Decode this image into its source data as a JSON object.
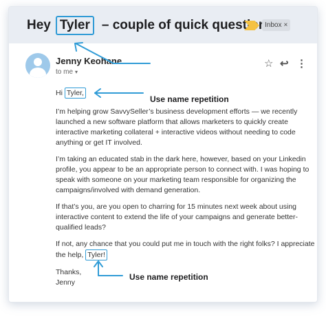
{
  "email": {
    "subject": {
      "prefix": "Hey",
      "name": "Tyler",
      "rest": "– couple of quick questions"
    },
    "label_chip": {
      "text": "Inbox",
      "close": "×"
    },
    "sender": {
      "name": "Jenny Keohane",
      "to": "to me",
      "caret": "▾"
    },
    "actions": {
      "star": "☆",
      "reply": "↩",
      "more": "⋮"
    },
    "body": {
      "greeting_prefix": "Hi",
      "greeting_name": "Tyler,",
      "p1": [
        "I’m helping grow SavvySeller’s business development efforts — we recently",
        "launched a new software platform that allows marketers to quickly create",
        "interactive marketing collateral + interactive videos without needing to code",
        "anything or get IT involved."
      ],
      "p2": [
        "I’m taking an educated stab in the dark here, however, based on your Linkedin",
        "profile, you appear to be an appropriate person to connect with. I was hoping to",
        "speak with someone on your marketing team responsible for organizing the",
        "campaigns/involved with demand generation."
      ],
      "p3": [
        "If that’s you, are you open to charring for 15 minutes next week about using",
        "interactive content to extend the life of your campaigns and generate better-",
        "qualified leads?"
      ],
      "p4_line1": "If not, any chance that you could put me in touch with the right folks? I appreciate",
      "p4_line2_prefix": "the help,",
      "p4_name": "Tyler!",
      "signoff": [
        "Thanks,",
        "Jenny"
      ]
    }
  },
  "annotations": {
    "label_1": "Use name repetition",
    "label_2": "Use name repetition"
  },
  "colors": {
    "accent": "#2f9bd6",
    "header_bg": "#e9edf3",
    "important_marker": "#f5c243",
    "avatar": "#9ec9ea"
  }
}
